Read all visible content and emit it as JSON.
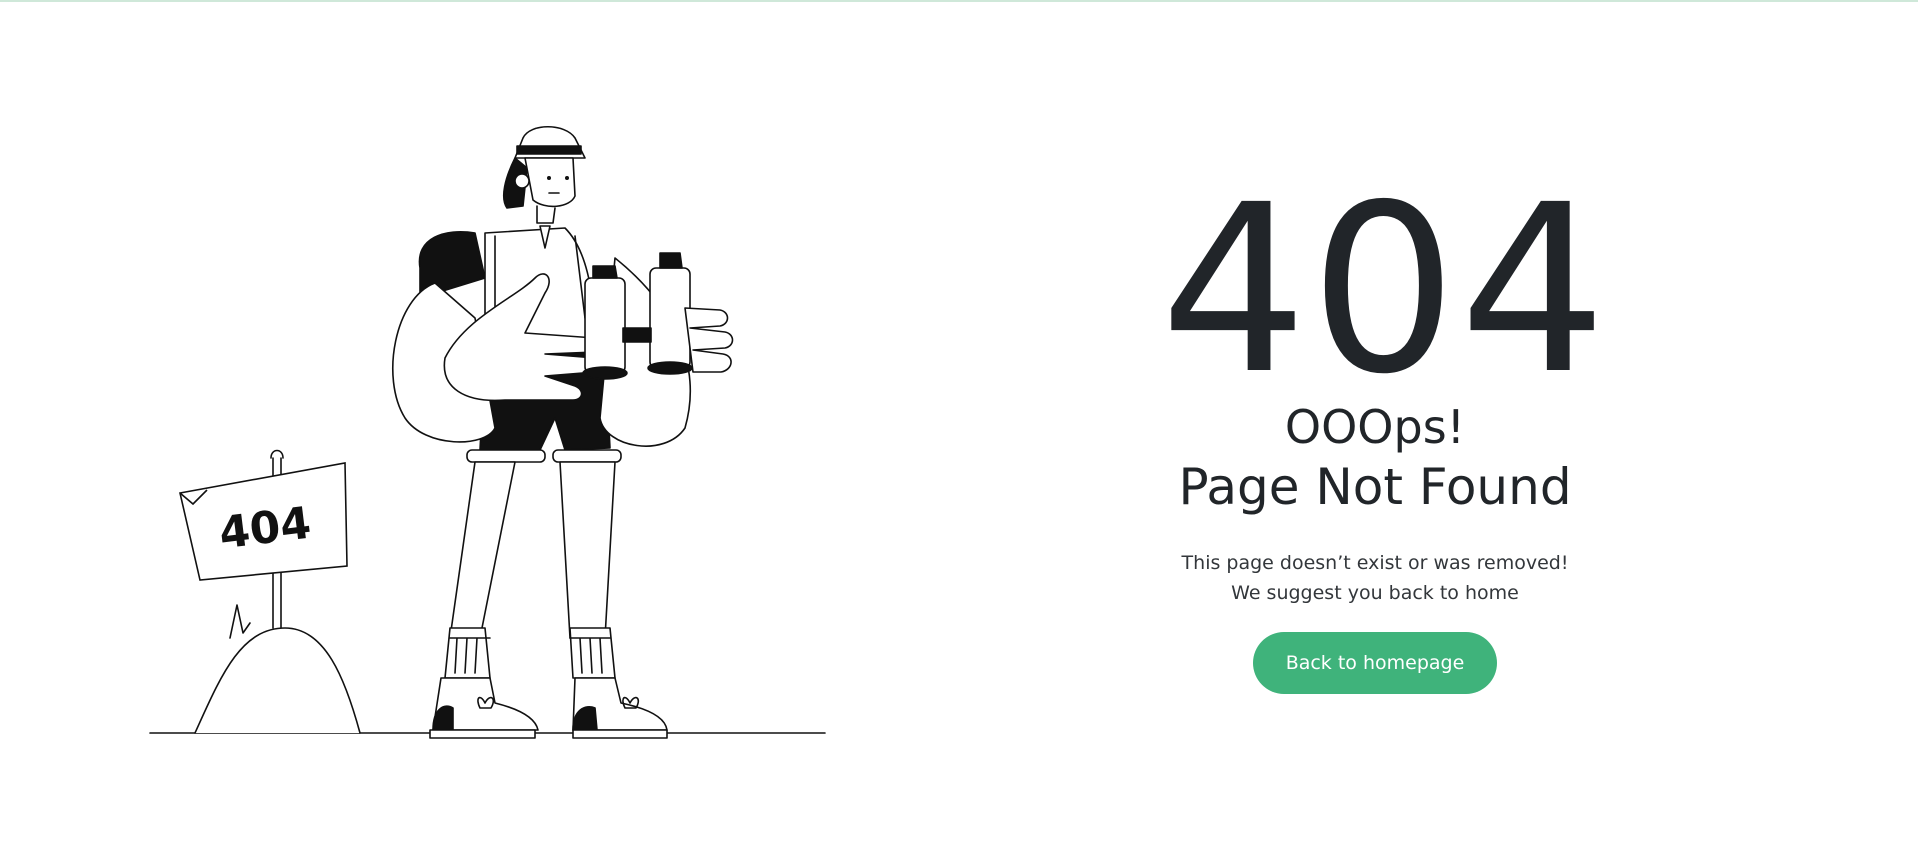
{
  "error": {
    "code": "404",
    "headline": "OOOps!",
    "subheadline": "Page Not Found",
    "message": "This page doesn’t exist or was removed! We suggest you back to home"
  },
  "actions": {
    "home_button_label": "Back to homepage"
  },
  "illustration": {
    "sign_text": "404",
    "description_icon": "hiker-with-binoculars-illustration"
  },
  "colors": {
    "accent": "#3fb37b",
    "text": "#212529",
    "top_border": "#cfe8d9"
  }
}
